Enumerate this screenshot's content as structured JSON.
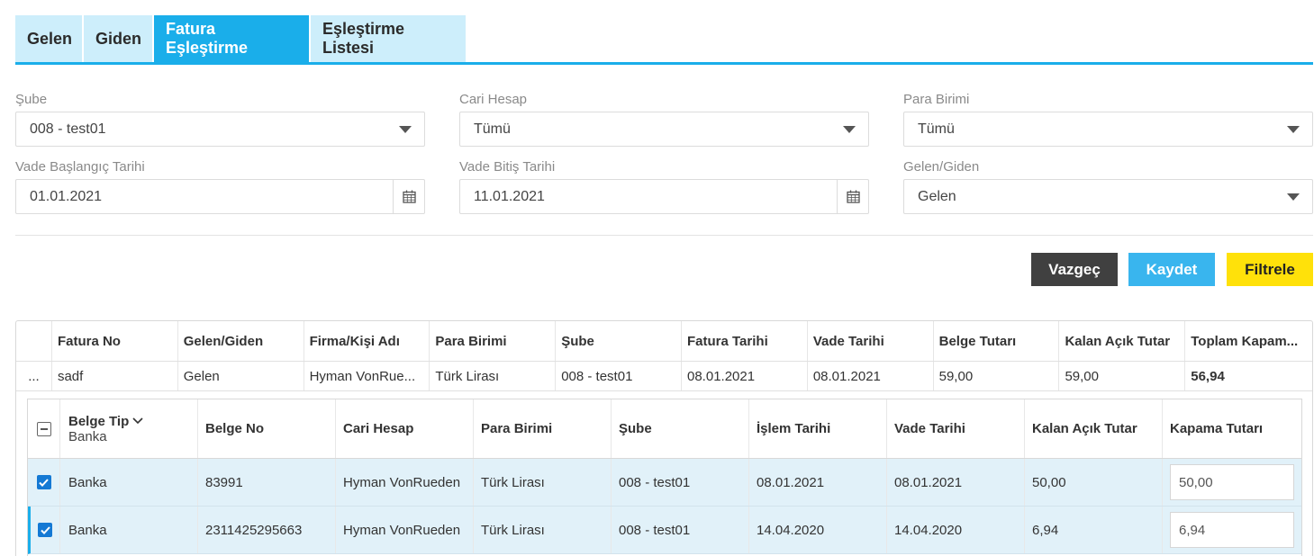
{
  "tabs": [
    {
      "label": "Gelen"
    },
    {
      "label": "Giden"
    },
    {
      "label": "Fatura Eşleştirme"
    },
    {
      "label": "Eşleştirme Listesi"
    }
  ],
  "filters": {
    "sube": {
      "label": "Şube",
      "value": "008 - test01"
    },
    "cari_hesap": {
      "label": "Cari Hesap",
      "value": "Tümü"
    },
    "para_birimi": {
      "label": "Para Birimi",
      "value": "Tümü"
    },
    "vade_baslangic": {
      "label": "Vade Başlangıç Tarihi",
      "value": "01.01.2021"
    },
    "vade_bitis": {
      "label": "Vade Bitiş Tarihi",
      "value": "11.01.2021"
    },
    "gelen_giden": {
      "label": "Gelen/Giden",
      "value": "Gelen"
    }
  },
  "actions": {
    "cancel": "Vazgeç",
    "save": "Kaydet",
    "filter": "Filtrele"
  },
  "grid": {
    "columns": [
      "Fatura No",
      "Gelen/Giden",
      "Firma/Kişi Adı",
      "Para Birimi",
      "Şube",
      "Fatura Tarihi",
      "Vade Tarihi",
      "Belge Tutarı",
      "Kalan Açık Tutar",
      "Toplam Kapam..."
    ],
    "row": {
      "expander": "...",
      "cells": [
        "sadf",
        "Gelen",
        "Hyman VonRue...",
        "Türk Lirası",
        "008 - test01",
        "08.01.2021",
        "08.01.2021",
        "59,00",
        "59,00",
        "56,94"
      ]
    }
  },
  "detail": {
    "group_header": "Belge Tip",
    "group_value": "Banka",
    "columns": [
      "Belge No",
      "Cari Hesap",
      "Para Birimi",
      "Şube",
      "İşlem Tarihi",
      "Vade Tarihi",
      "Kalan Açık Tutar",
      "Kapama Tutarı"
    ],
    "rows": [
      {
        "belge_tip": "Banka",
        "belge_no": "83991",
        "cari": "Hyman VonRueden",
        "para": "Türk Lirası",
        "sube": "008 - test01",
        "islem": "08.01.2021",
        "vade": "08.01.2021",
        "kalan": "50,00",
        "kapama": "50,00"
      },
      {
        "belge_tip": "Banka",
        "belge_no": "2311425295663",
        "cari": "Hyman VonRueden",
        "para": "Türk Lirası",
        "sube": "008 - test01",
        "islem": "14.04.2020",
        "vade": "14.04.2020",
        "kalan": "6,94",
        "kapama": "6,94"
      }
    ]
  },
  "colors": {
    "accent": "#1aaeea",
    "tab_inactive": "#cdeefb",
    "cancel": "#404040",
    "save": "#39b5ee",
    "filter": "#ffe10a",
    "row_selected": "#e1f1f9"
  }
}
